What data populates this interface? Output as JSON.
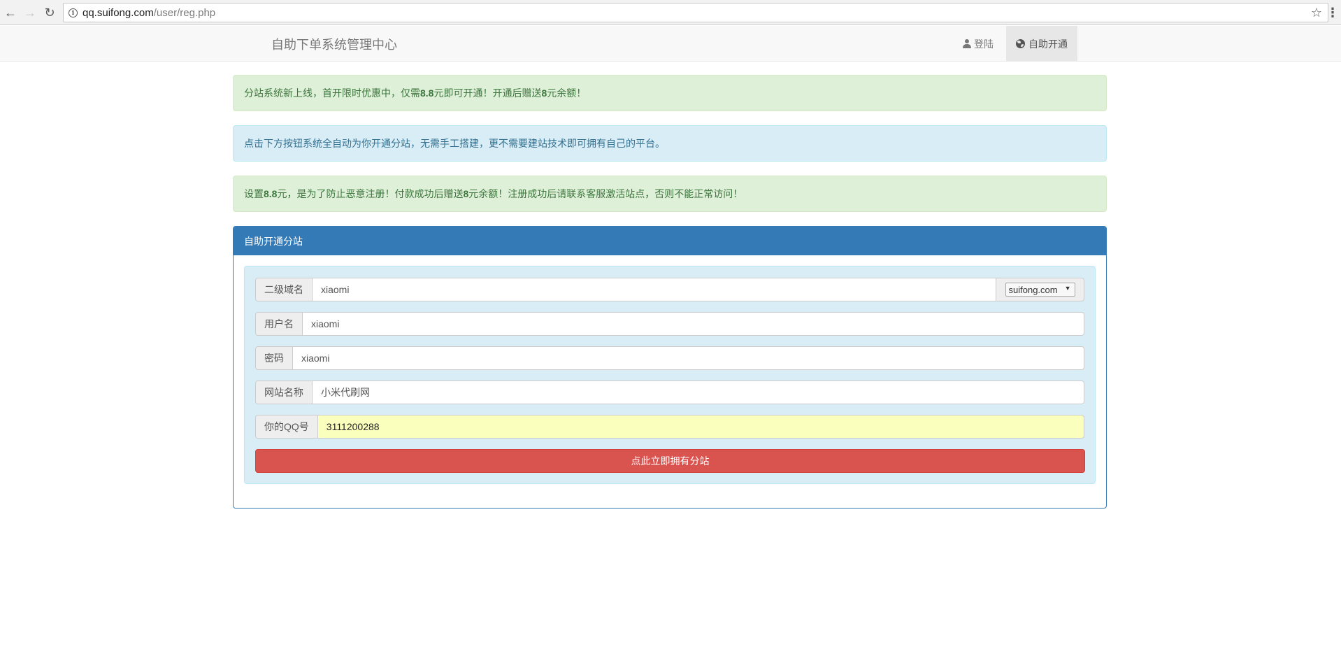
{
  "browser": {
    "url_host": "qq.suifong.com",
    "url_path": "/user/reg.php"
  },
  "navbar": {
    "brand": "自助下单系统管理中心",
    "login_label": "登陆",
    "open_label": "自助开通"
  },
  "alerts": {
    "promo": {
      "part1": "分站系统新上线，首开限时优惠中，仅需",
      "price": "8.8",
      "part2": "元即可开通！开通后赠送",
      "bonus": "8",
      "part3": "元余额！"
    },
    "info": "点击下方按钮系统全自动为你开通分站，无需手工搭建，更不需要建站技术即可拥有自己的平台。",
    "notice": {
      "part1": "设置",
      "price": "8.8",
      "part2": "元，是为了防止恶意注册！付款成功后赠送",
      "bonus": "8",
      "part3": "元余额！注册成功后请联系客服激活站点，否则不能正常访问！"
    }
  },
  "panel": {
    "title": "自助开通分站",
    "form": {
      "subdomain": {
        "label": "二级域名",
        "value": "xiaomi",
        "domain_option": "suifong.com"
      },
      "username": {
        "label": "用户名",
        "value": "xiaomi"
      },
      "password": {
        "label": "密码",
        "value": "xiaomi"
      },
      "site_name": {
        "label": "网站名称",
        "value": "小米代刷网"
      },
      "qq": {
        "label": "你的QQ号",
        "value": "3111200288"
      }
    },
    "submit_label": "点此立即拥有分站"
  },
  "colors": {
    "primary": "#337ab7",
    "danger": "#d9534f",
    "success_bg": "#dff0d8",
    "info_bg": "#d9edf7",
    "autofill_bg": "#faffbd"
  }
}
